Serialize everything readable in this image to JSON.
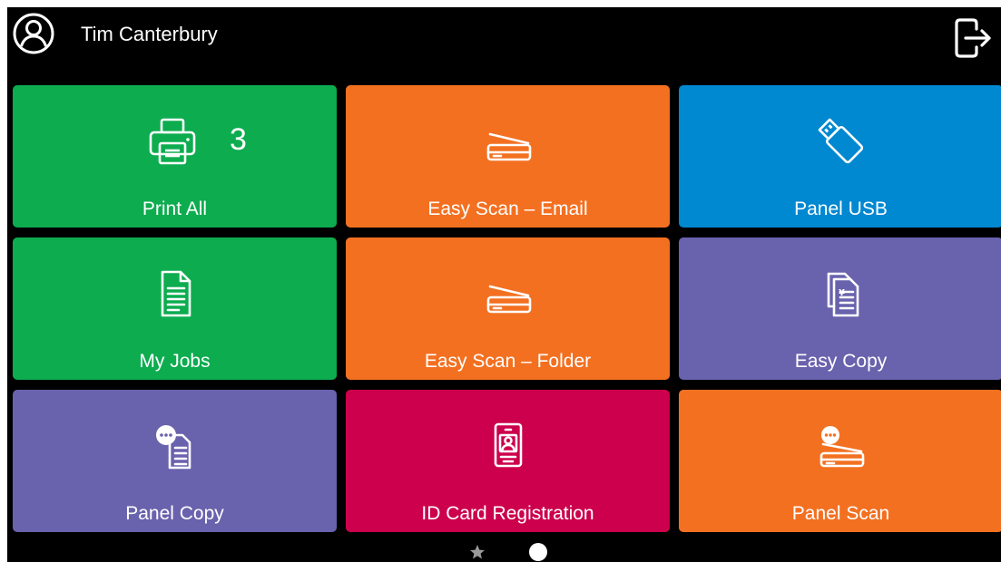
{
  "header": {
    "user_name": "Tim Canterbury",
    "user_icon": "user-circle-icon",
    "logout_icon": "logout-icon"
  },
  "tiles": [
    {
      "label": "Print All",
      "icon": "printer-icon",
      "count": "3",
      "color": "#0dac4f"
    },
    {
      "label": "Easy Scan – Email",
      "icon": "scanner-icon",
      "color": "#f37021"
    },
    {
      "label": "Panel USB",
      "icon": "usb-drive-icon",
      "color": "#0088d1"
    },
    {
      "label": "My Jobs",
      "icon": "document-icon",
      "color": "#0dac4f"
    },
    {
      "label": "Easy Scan – Folder",
      "icon": "scanner-icon",
      "color": "#f37021"
    },
    {
      "label": "Easy Copy",
      "icon": "copy-documents-icon",
      "color": "#6962ad"
    },
    {
      "label": "Panel Copy",
      "icon": "panel-copy-icon",
      "color": "#6962ad"
    },
    {
      "label": "ID Card Registration",
      "icon": "id-card-icon",
      "color": "#cc004c"
    },
    {
      "label": "Panel Scan",
      "icon": "panel-scan-icon",
      "color": "#f37021"
    }
  ],
  "pager": {
    "favorites_icon": "star-icon",
    "page_indicator_icon": "page-dot-icon"
  }
}
